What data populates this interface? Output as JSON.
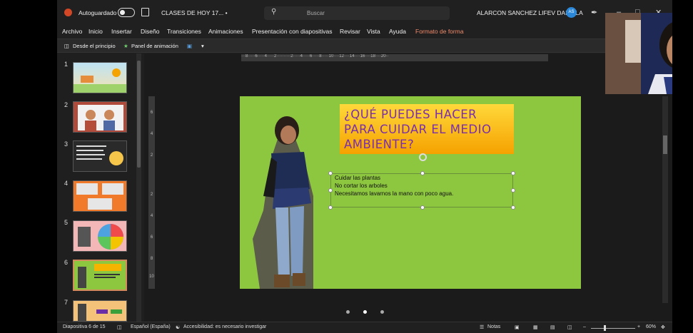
{
  "titlebar": {
    "autosave_label": "Autoguardado",
    "document_title": "CLASES DE HOY 17... •",
    "search_placeholder": "Buscar",
    "user_name": "ALARCON SANCHEZ LIFEV DANIELA",
    "avatar_initials": "AS"
  },
  "ribbon": {
    "tabs": [
      "Archivo",
      "Inicio",
      "Insertar",
      "Diseño",
      "Transiciones",
      "Animaciones",
      "Presentación con diapositivas",
      "Revisar",
      "Vista",
      "Ayuda",
      "Formato de forma"
    ],
    "active_tab": "Formato de forma"
  },
  "toolbar": {
    "from_start": "Desde el principio",
    "animation_pane": "Panel de animación"
  },
  "ruler": {
    "horizontal": "···8·····6·····4·····2··········2·····4·····6·····8·····10····12····14····16····18····20··"
  },
  "thumbnails": [
    {
      "number": "1",
      "bg": "#bfe3f5"
    },
    {
      "number": "2",
      "bg": "#b04a3a"
    },
    {
      "number": "3",
      "bg": "#2a2a2a"
    },
    {
      "number": "4",
      "bg": "#f07a2a"
    },
    {
      "number": "5",
      "bg": "#f4b7b7"
    },
    {
      "number": "6",
      "bg": "#8dc63f"
    },
    {
      "number": "7",
      "bg": "#f5c27a"
    }
  ],
  "slide": {
    "title": "¿QUÉ PUEDES HACER PARA CUIDAR EL MEDIO AMBIENTE?",
    "bullets": [
      "Cuidar las plantas",
      "No cortar los arboles",
      "Necesitamos lavarnos la mano con poco agua."
    ],
    "background_color": "#8dc63f",
    "title_color": "#7a2fa8"
  },
  "statusbar": {
    "slide_info": "Diapositiva 6 de 15",
    "language": "Español (España)",
    "accessibility": "Accesibilidad: es necesario investigar",
    "notes": "Notas",
    "zoom": "60%"
  }
}
